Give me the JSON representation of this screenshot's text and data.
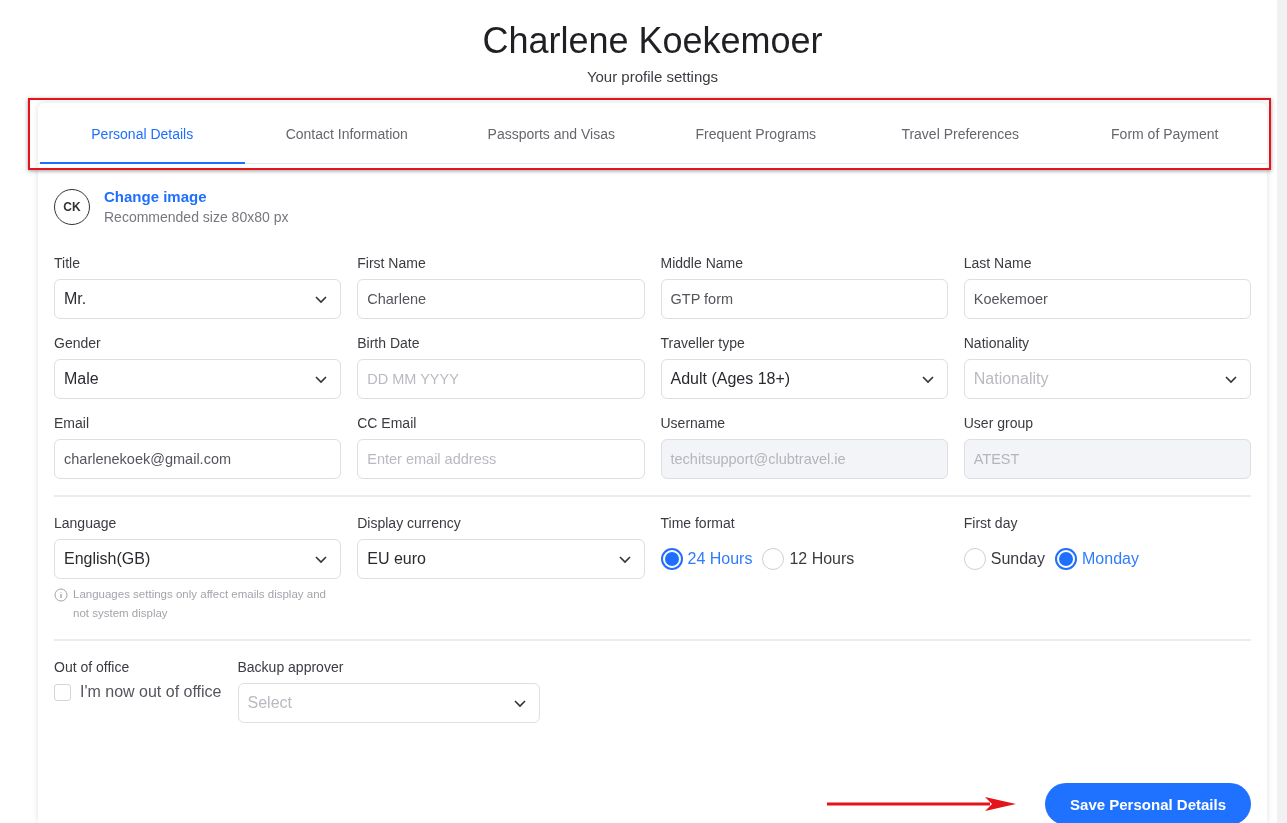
{
  "header": {
    "name": "Charlene Koekemoer",
    "subtitle": "Your profile settings"
  },
  "tabs": [
    {
      "label": "Personal Details",
      "selected": true
    },
    {
      "label": "Contact Information",
      "selected": false
    },
    {
      "label": "Passports and Visas",
      "selected": false
    },
    {
      "label": "Frequent Programs",
      "selected": false
    },
    {
      "label": "Travel Preferences",
      "selected": false
    },
    {
      "label": "Form of Payment",
      "selected": false
    }
  ],
  "avatar": {
    "initials": "CK",
    "link": "Change image",
    "hint": "Recommended size 80x80 px"
  },
  "sections": [
    {
      "fields": [
        {
          "kind": "select",
          "label": "Title",
          "value": "Mr."
        },
        {
          "kind": "input",
          "label": "First Name",
          "value": "Charlene"
        },
        {
          "kind": "input",
          "label": "Middle Name",
          "value": "GTP form"
        },
        {
          "kind": "input",
          "label": "Last Name",
          "value": "Koekemoer"
        },
        {
          "kind": "select",
          "label": "Gender",
          "value": "Male"
        },
        {
          "kind": "input",
          "label": "Birth Date",
          "placeholder": "DD MM YYYY"
        },
        {
          "kind": "select",
          "label": "Traveller type",
          "value": "Adult (Ages 18+)"
        },
        {
          "kind": "select",
          "label": "Nationality",
          "placeholder": "Nationality"
        },
        {
          "kind": "input",
          "label": "Email",
          "value": "charlenekoek@gmail.com"
        },
        {
          "kind": "input",
          "label": "CC Email",
          "placeholder": "Enter email address"
        },
        {
          "kind": "input",
          "label": "Username",
          "value": "techitsupport@clubtravel.ie",
          "disabled": true
        },
        {
          "kind": "input",
          "label": "User group",
          "value": "ATEST",
          "disabled": true
        }
      ]
    },
    {
      "fields": [
        {
          "kind": "select",
          "label": "Language",
          "value": "English(GB)",
          "note": "Languages settings only affect emails display and not system display"
        },
        {
          "kind": "select",
          "label": "Display currency",
          "value": "EU euro"
        },
        {
          "kind": "radio",
          "label": "Time format",
          "options": [
            {
              "label": "24 Hours",
              "selected": true
            },
            {
              "label": "12 Hours",
              "selected": false
            }
          ]
        },
        {
          "kind": "radio",
          "label": "First day",
          "options": [
            {
              "label": "Sunday",
              "selected": false
            },
            {
              "label": "Monday",
              "selected": true
            }
          ]
        }
      ]
    },
    {
      "fields": [
        {
          "kind": "checkbox",
          "label": "Out of office",
          "text": "I'm now out of office",
          "checked": false
        },
        {
          "kind": "select",
          "label": "Backup approver",
          "placeholder": "Select"
        }
      ]
    }
  ],
  "save_button": "Save Personal Details"
}
